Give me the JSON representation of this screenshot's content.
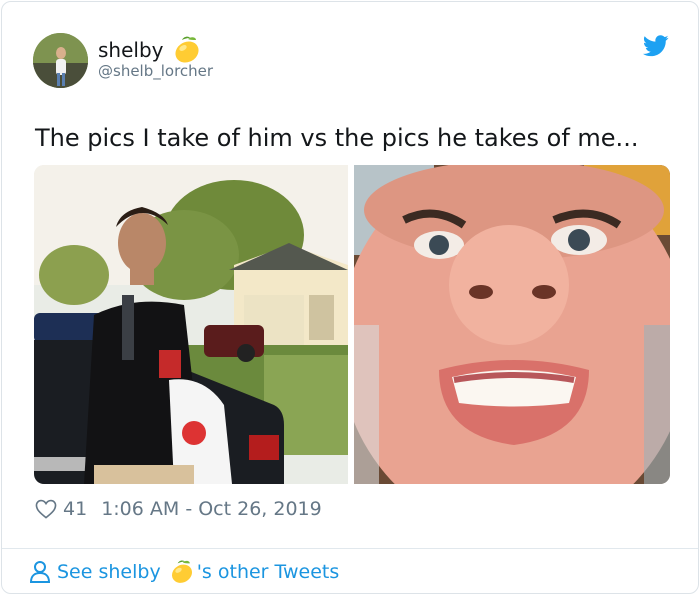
{
  "tweet": {
    "author": {
      "display_name": "shelby",
      "handle": "@shelb_lorcher",
      "name_emoji": "lemon"
    },
    "text": "The pics I take of him vs the pics he takes of me...",
    "like_count": "41",
    "timestamp": "1:06 AM - Oct 26, 2019",
    "brand_icon": "twitter-bird-icon",
    "brand_color": "#1da1f2"
  },
  "footer": {
    "link_prefix": "See shelby",
    "link_suffix": "'s other Tweets",
    "link_color": "#1b95e0"
  },
  "colors": {
    "text_primary": "#14171a",
    "text_secondary": "#657786",
    "border": "#e1e8ed"
  }
}
